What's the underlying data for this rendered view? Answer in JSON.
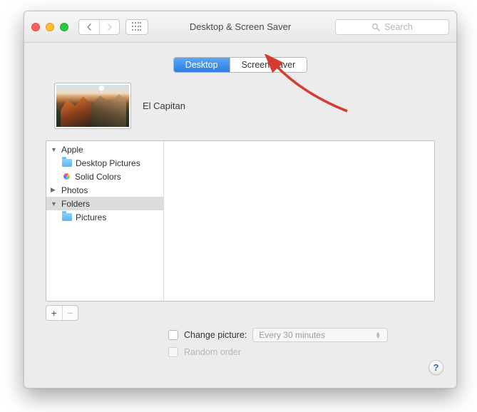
{
  "window": {
    "title": "Desktop & Screen Saver"
  },
  "search": {
    "placeholder": "Search"
  },
  "tabs": {
    "desktop": "Desktop",
    "screensaver": "Screen Saver",
    "active": "desktop"
  },
  "wallpaper": {
    "name": "El Capitan"
  },
  "sidebar": {
    "apple": {
      "label": "Apple",
      "expanded": true
    },
    "desktop_pictures": "Desktop Pictures",
    "solid_colors": "Solid Colors",
    "photos": {
      "label": "Photos",
      "expanded": false
    },
    "folders": {
      "label": "Folders",
      "expanded": true,
      "selected": true
    },
    "pictures": "Pictures"
  },
  "controls": {
    "change_picture_label": "Change picture:",
    "change_picture_interval": "Every 30 minutes",
    "random_order_label": "Random order"
  },
  "help": {
    "glyph": "?"
  },
  "buttons": {
    "plus": "+",
    "minus": "−"
  }
}
